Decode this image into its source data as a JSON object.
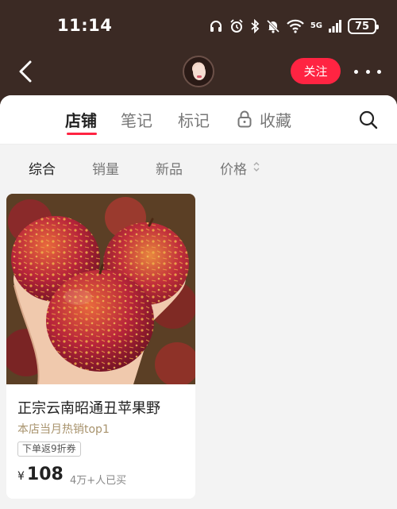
{
  "status_bar": {
    "time": "11:14",
    "network": "5G",
    "battery": "75",
    "icons": [
      "headphones-icon",
      "alarm-icon",
      "bluetooth-icon",
      "mute-icon",
      "wifi-icon",
      "signal-icon",
      "battery-icon"
    ]
  },
  "header": {
    "follow_label": "关注",
    "icons": [
      "back-icon",
      "avatar",
      "more-icon"
    ]
  },
  "tabs": [
    {
      "label": "店铺",
      "active": true
    },
    {
      "label": "笔记",
      "active": false
    },
    {
      "label": "标记",
      "active": false
    },
    {
      "label": "收藏",
      "active": false,
      "icon": "lock-icon"
    }
  ],
  "sort": [
    {
      "label": "综合",
      "active": true
    },
    {
      "label": "销量",
      "active": false
    },
    {
      "label": "新品",
      "active": false
    },
    {
      "label": "价格",
      "active": false,
      "icon": "sort-arrows-icon"
    }
  ],
  "products": [
    {
      "title": "正宗云南昭通丑苹果野",
      "subtitle": "本店当月热销top1",
      "coupon": "下单返9折券",
      "currency": "¥",
      "price": "108",
      "sold": "4万+人已买"
    }
  ],
  "colors": {
    "header_bg": "#3b2a24",
    "accent": "#ff2442",
    "subtitle": "#a8936d"
  }
}
